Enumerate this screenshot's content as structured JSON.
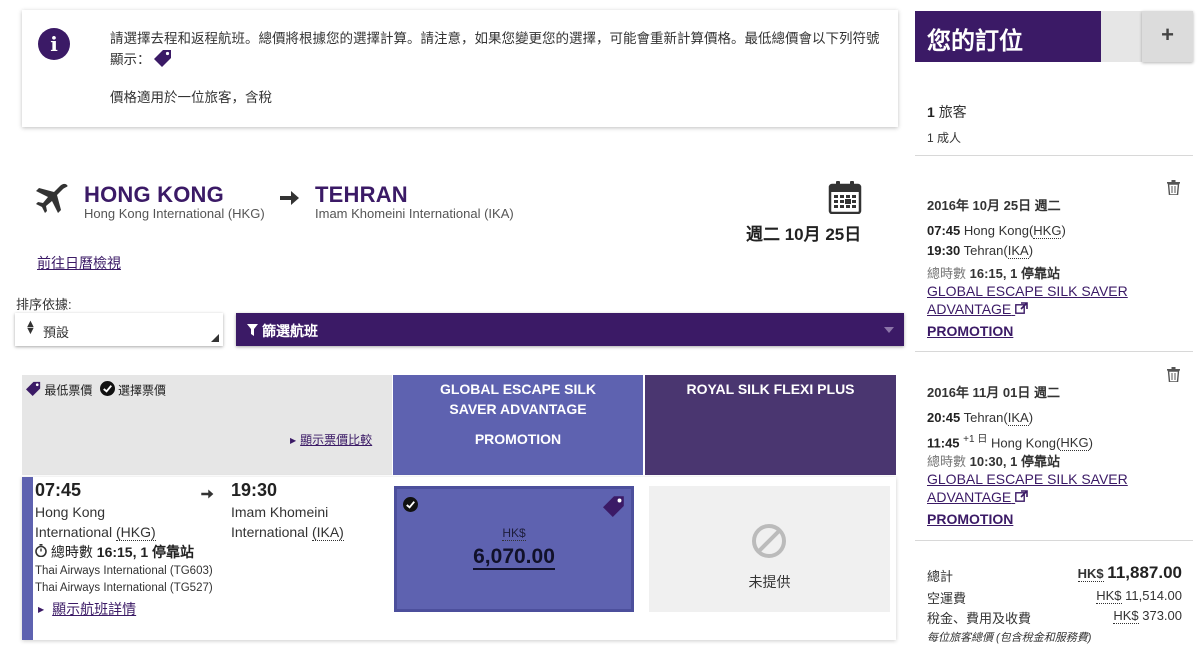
{
  "info": {
    "line1": "請選擇去程和返程航班。總價將根據您的選擇計算。請注意，如果您變更您的選擇，可能會重新計算價格。最低總價會以下列符號顯示：",
    "line2": "價格適用於一位旅客，含稅"
  },
  "route": {
    "from_city": "HONG KONG",
    "from_airport": "Hong Kong International (HKG)",
    "to_city": "TEHRAN",
    "to_airport": "Imam Khomeini International (IKA)",
    "date": "週二 10月 25日",
    "calendar_link": "前往日曆檢視"
  },
  "sort": {
    "label": "排序依據:",
    "value": "預設"
  },
  "filter": {
    "label": "篩選航班"
  },
  "fare_table": {
    "legend_lowest": "最低票價",
    "legend_selected": "選擇票價",
    "compare_link": "顯示票價比較",
    "columns": [
      {
        "name": "GLOBAL ESCAPE SILK SAVER ADVANTAGE",
        "promo": "PROMOTION",
        "color": "#5e62b0"
      },
      {
        "name": "ROYAL SILK FLEXI PLUS",
        "promo": "",
        "color": "#4a3670"
      }
    ]
  },
  "flight": {
    "dep_time": "07:45",
    "dep_place_line1": "Hong Kong",
    "dep_place_line2": "International",
    "dep_code": "(HKG)",
    "arr_time": "19:30",
    "arr_place_line1": "Imam Khomeini",
    "arr_place_line2": "International",
    "arr_code": "(IKA)",
    "duration_label": "總時數",
    "duration_value": "16:15",
    "stops": "1 停靠站",
    "carrier1": "Thai Airways International (TG603)",
    "carrier2": "Thai Airways International (TG527)",
    "details_link": "顯示航班詳情",
    "fare_currency": "HK$",
    "fare_amount": "6,070.00",
    "na_label": "未提供"
  },
  "booking": {
    "title": "您的訂位",
    "plus": "+",
    "passengers_count": "1",
    "passengers_label": "旅客",
    "adults": "1 成人",
    "seg1": {
      "date": "2016年 10月 25日 週二",
      "dep_time": "07:45",
      "dep_place": "Hong Kong",
      "dep_code": "HKG",
      "arr_time": "19:30",
      "arr_place": "Tehran",
      "arr_code": "IKA",
      "arr_day_offset": "",
      "duration_label": "總時數",
      "duration": "16:15",
      "stops": "1 停靠站",
      "fare_line1": "GLOBAL ESCAPE SILK SAVER",
      "fare_line2": "ADVANTAGE",
      "promo": "PROMOTION"
    },
    "seg2": {
      "date": "2016年 11月 01日 週二",
      "dep_time": "20:45",
      "dep_place": "Tehran",
      "dep_code": "IKA",
      "arr_time": "11:45",
      "arr_day_offset": "+1 日",
      "arr_place": "Hong Kong",
      "arr_code": "HKG",
      "duration_label": "總時數",
      "duration": "10:30",
      "stops": "1 停靠站",
      "fare_line1": "GLOBAL ESCAPE SILK SAVER",
      "fare_line2": "ADVANTAGE",
      "promo": "PROMOTION"
    },
    "total_label": "總計",
    "total_currency": "HK$",
    "total_amount": "11,887.00",
    "fare_label": "空運費",
    "fare_currency": "HK$",
    "fare_amount": "11,514.00",
    "tax_label": "稅金、費用及收費",
    "tax_currency": "HK$",
    "tax_amount": "373.00",
    "note": "每位旅客總價 (包含稅金和服務費)"
  },
  "colors": {
    "brand_purple": "#3b1a66",
    "fare_blue": "#5e62b0",
    "fare_dark": "#4a3670"
  },
  "icons": [
    "info-icon",
    "plane-icon",
    "arrow-right-icon",
    "calendar-icon",
    "sort-updown-icon",
    "funnel-icon",
    "price-tag-icon",
    "check-circle-icon",
    "stopwatch-icon",
    "ban-icon",
    "trash-icon",
    "external-link-icon",
    "plus-icon"
  ]
}
